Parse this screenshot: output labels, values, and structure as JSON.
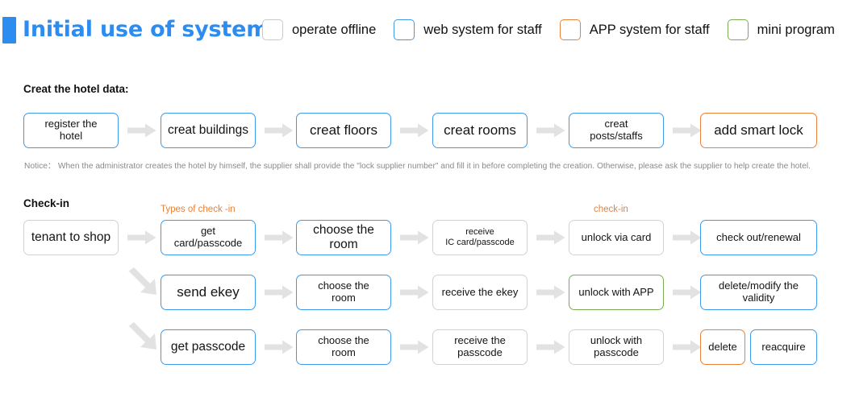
{
  "header": {
    "title": "Initial use of system",
    "accent_color": "#2d8cf0",
    "legend": [
      {
        "label": "operate offline",
        "swatch": "checkbox-gray",
        "color": "#c9c9c9"
      },
      {
        "label": "web system for staff",
        "swatch": "checkbox-blue",
        "color": "#3d9ae8"
      },
      {
        "label": "APP system for staff",
        "swatch": "checkbox-orange",
        "color": "#e8823a"
      },
      {
        "label": "mini program",
        "swatch": "checkbox-green",
        "color": "#79ab52"
      }
    ]
  },
  "sections": {
    "hotel_data": {
      "title": "Creat the hotel data:",
      "notice": "Notice： When the administrator creates the hotel by himself, the supplier shall provide the \"lock supplier number\" and fill it in before completing the creation. Otherwise, please ask the supplier to help create the hotel.",
      "steps": [
        {
          "label": "register the\nhotel",
          "style": "blue",
          "size": "md"
        },
        {
          "label": "creat buildings",
          "style": "blue",
          "size": "lg"
        },
        {
          "label": "creat floors",
          "style": "blue",
          "size": "xl"
        },
        {
          "label": "creat rooms",
          "style": "blue",
          "size": "xl"
        },
        {
          "label": "creat\nposts/staffs",
          "style": "blue",
          "size": "md"
        },
        {
          "label": "add smart lock",
          "style": "orange",
          "size": "xl"
        }
      ]
    },
    "check_in": {
      "title": "Check-in",
      "captions": [
        {
          "text": "Types of check -in",
          "color": "#e8823a"
        },
        {
          "text": "check-in",
          "color": "#e8823a"
        }
      ],
      "entry": {
        "label": "tenant to shop",
        "style": "gray",
        "size": "lg"
      },
      "rows": [
        {
          "steps": [
            {
              "label": "get\ncard/passcode",
              "style": "blue",
              "size": "md"
            },
            {
              "label": "choose the\nroom",
              "style": "blue",
              "size": "lg"
            },
            {
              "label": "receive\nIC card/passcode",
              "style": "gray",
              "size": "sm"
            },
            {
              "label": "unlock via card",
              "style": "gray",
              "size": "md"
            },
            {
              "label": "check out/renewal",
              "style": "blue",
              "size": "md"
            }
          ]
        },
        {
          "steps": [
            {
              "label": "send ekey",
              "style": "blue",
              "size": "xl"
            },
            {
              "label": "choose the\nroom",
              "style": "blue",
              "size": "md"
            },
            {
              "label": "receive the ekey",
              "style": "gray",
              "size": "md"
            },
            {
              "label": "unlock with APP",
              "style": "green",
              "size": "md"
            },
            {
              "label": "delete/modify the\nvalidity",
              "style": "blue",
              "size": "md"
            }
          ]
        },
        {
          "steps": [
            {
              "label": "get passcode",
              "style": "blue",
              "size": "lg"
            },
            {
              "label": "choose the\nroom",
              "style": "blue",
              "size": "md"
            },
            {
              "label": "receive the\npasscode",
              "style": "gray",
              "size": "md"
            },
            {
              "label": "unlock with\npasscode",
              "style": "gray",
              "size": "md"
            },
            {
              "label": "delete",
              "style": "orange",
              "size": "md"
            },
            {
              "label": "reacquire",
              "style": "blue",
              "size": "md"
            }
          ]
        }
      ]
    }
  }
}
